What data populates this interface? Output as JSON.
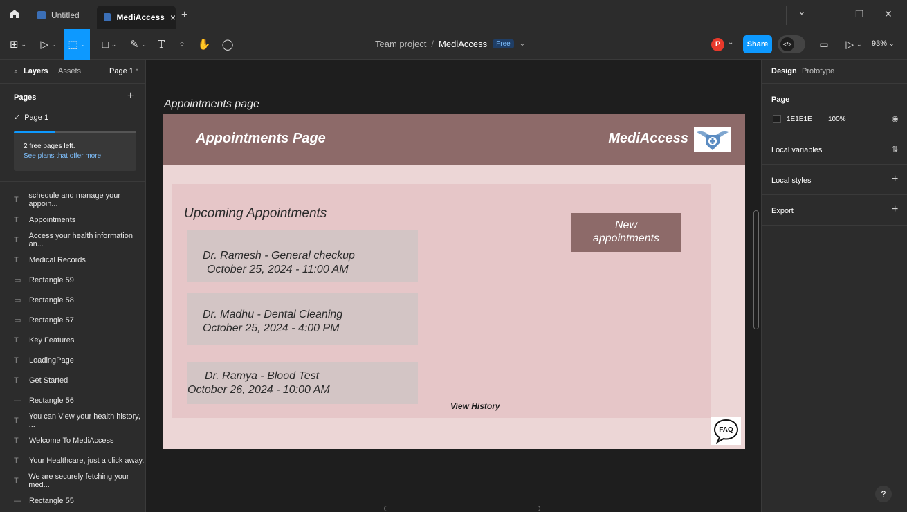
{
  "titlebar": {
    "tabs": [
      {
        "label": "Untitled"
      },
      {
        "label": "MediAccess"
      }
    ],
    "close_tab": "×",
    "new_tab": "+",
    "window": {
      "minimize": "–",
      "restore": "❐",
      "close": "✕",
      "chevron": "⌄"
    }
  },
  "toolbar": {
    "breadcrumb": {
      "team": "Team project",
      "sep": "/",
      "file": "MediAccess",
      "badge": "Free"
    },
    "avatar_initial": "P",
    "share_label": "Share",
    "zoom": "93%"
  },
  "left_panel": {
    "tabs": [
      "Layers",
      "Assets"
    ],
    "page_selector": "Page 1",
    "pages_heading": "Pages",
    "current_page": "Page 1",
    "free_pages_text": "2 free pages left.",
    "plans_link": "See plans that offer more",
    "layers": [
      {
        "type": "text",
        "label": "schedule and manage your appoin..."
      },
      {
        "type": "text",
        "label": "Appointments"
      },
      {
        "type": "text",
        "label": "Access your health information an..."
      },
      {
        "type": "text",
        "label": "Medical Records"
      },
      {
        "type": "rect",
        "label": "Rectangle 59"
      },
      {
        "type": "rect",
        "label": "Rectangle 58"
      },
      {
        "type": "rect",
        "label": "Rectangle 57"
      },
      {
        "type": "text",
        "label": "Key Features"
      },
      {
        "type": "text",
        "label": "LoadingPage"
      },
      {
        "type": "text",
        "label": "Get Started"
      },
      {
        "type": "line",
        "label": "Rectangle 56"
      },
      {
        "type": "text",
        "label": "You can View your health history, ..."
      },
      {
        "type": "text",
        "label": "Welcome To MediAccess"
      },
      {
        "type": "text",
        "label": "Your Healthcare, just a click away."
      },
      {
        "type": "text",
        "label": "We are securely fetching your med..."
      },
      {
        "type": "line",
        "label": "Rectangle 55"
      }
    ]
  },
  "right_panel": {
    "tabs": [
      "Design",
      "Prototype"
    ],
    "page_heading": "Page",
    "page_color": "1E1E1E",
    "page_opacity": "100%",
    "local_variables": "Local variables",
    "local_styles": "Local styles",
    "export": "Export",
    "help": "?"
  },
  "canvas": {
    "frame_label": "Appointments page",
    "header_title": "Appointments Page",
    "brand": "MediAccess",
    "upcoming_title": "Upcoming Appointments",
    "appointments": [
      {
        "line1": "Dr. Ramesh - General checkup",
        "line2": "October 25, 2024 - 11:00 AM"
      },
      {
        "line1": "Dr. Madhu - Dental Cleaning",
        "line2": "October 25, 2024 - 4:00 PM"
      },
      {
        "line1": "Dr. Ramya - Blood Test",
        "line2": "October 26, 2024 - 10:00 AM"
      }
    ],
    "new_btn_line1": "New",
    "new_btn_line2": "appointments",
    "view_history": "View History",
    "faq_label": "FAQ"
  },
  "colors": {
    "accent": "#0d99ff",
    "header_brown": "#8d6a69",
    "frame_bg": "#ecd6d6",
    "panel_pink": "#e6c6c8",
    "card_gray": "#d3c5c5",
    "avatar": "#e8392b"
  }
}
